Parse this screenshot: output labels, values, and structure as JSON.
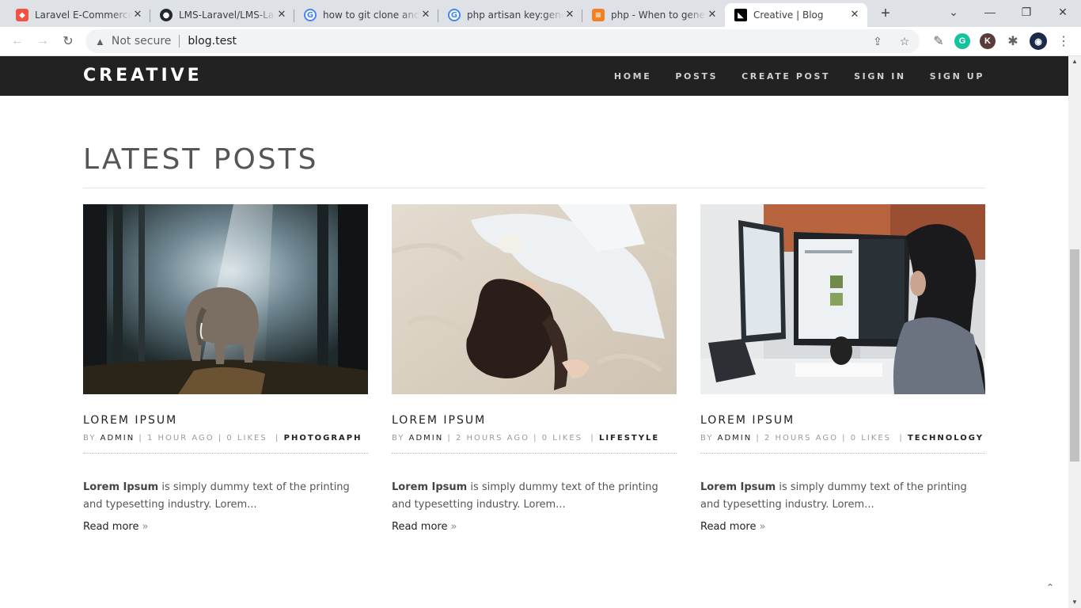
{
  "browser": {
    "tabs": [
      {
        "title": "Laravel E-Commerce A",
        "icon": "laravel-icon",
        "color": "#f05340"
      },
      {
        "title": "LMS-Laravel/LMS-Lara",
        "icon": "github-icon",
        "color": "#24292e"
      },
      {
        "title": "how to git clone and r",
        "icon": "google-icon",
        "color": "#4285f4"
      },
      {
        "title": "php artisan key:genera",
        "icon": "google-icon",
        "color": "#4285f4"
      },
      {
        "title": "php - When to genera",
        "icon": "stackoverflow-icon",
        "color": "#f48024"
      },
      {
        "title": "Creative | Blog",
        "icon": "site-favicon-icon",
        "color": "#000000"
      }
    ],
    "new_tab": "+",
    "omnibox": {
      "security": "Not secure",
      "url": "blog.test"
    },
    "extensions": [
      {
        "letter": "G",
        "color": "#15c39a"
      },
      {
        "letter": "K",
        "color": "#5a3b3b"
      }
    ]
  },
  "site": {
    "brand": "CREATIVE",
    "nav": [
      "HOME",
      "POSTS",
      "CREATE POST",
      "SIGN IN",
      "SIGN UP"
    ],
    "section_title": "LATEST POSTS",
    "posts": [
      {
        "title": "LOREM IPSUM",
        "by": "BY",
        "author": "ADMIN",
        "time": "1 HOUR AGO",
        "likes": "0 LIKES",
        "category": "PHOTOGRAPH",
        "excerpt_bold": "Lorem Ipsum",
        "excerpt": " is simply dummy text of the printing and typesetting industry. Lorem...",
        "read_more": "Read more",
        "image": "elephant-forest"
      },
      {
        "title": "LOREM IPSUM",
        "by": "BY",
        "author": "ADMIN",
        "time": "2 HOURS AGO",
        "likes": "0 LIKES",
        "category": "LIFESTYLE",
        "excerpt_bold": "Lorem Ipsum",
        "excerpt": " is simply dummy text of the printing and typesetting industry. Lorem...",
        "read_more": "Read more",
        "image": "woman-lying-on-fur"
      },
      {
        "title": "LOREM IPSUM",
        "by": "BY",
        "author": "ADMIN",
        "time": "2 HOURS AGO",
        "likes": "0 LIKES",
        "category": "TECHNOLOGY",
        "excerpt_bold": "Lorem Ipsum",
        "excerpt": " is simply dummy text of the printing and typesetting industry. Lorem...",
        "read_more": "Read more",
        "image": "woman-at-computer"
      }
    ],
    "to_top": "⌃"
  }
}
